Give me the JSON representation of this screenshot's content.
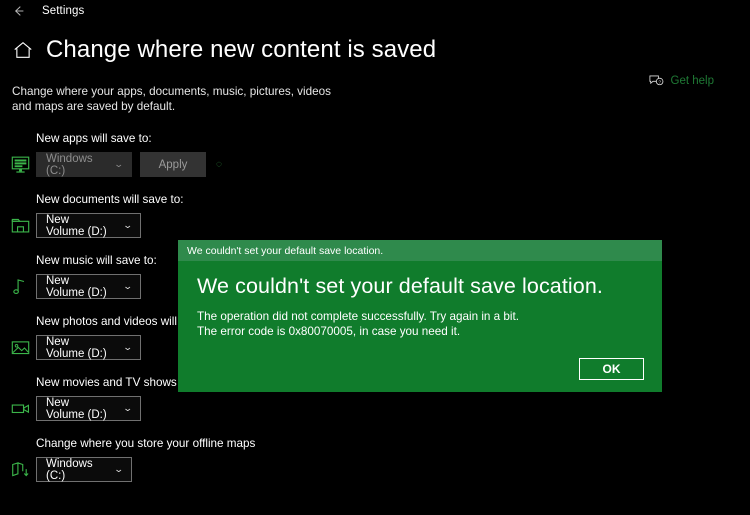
{
  "window": {
    "back_icon": "back-arrow-icon",
    "title": "Settings"
  },
  "header": {
    "home_icon": "home-icon",
    "title": "Change where new content is saved"
  },
  "description": "Change where your apps, documents, music, pictures, videos and maps are saved by default.",
  "help": {
    "icon": "help-chat-icon",
    "label": "Get help",
    "color": "#1f7a35"
  },
  "settings": [
    {
      "icon": "monitor-icon",
      "label": "New apps will save to:",
      "value": "Windows (C:)",
      "disabled": true,
      "apply_label": "Apply",
      "has_apply": true,
      "has_spinner": true,
      "width_class": "w-apps"
    },
    {
      "icon": "folder-icon",
      "label": "New documents will save to:",
      "value": "New Volume (D:)",
      "disabled": false,
      "has_apply": false,
      "has_spinner": false,
      "width_class": "w-vol"
    },
    {
      "icon": "music-note-icon",
      "label": "New music will save to:",
      "value": "New Volume (D:)",
      "disabled": false,
      "has_apply": false,
      "has_spinner": false,
      "width_class": "w-vol"
    },
    {
      "icon": "photo-icon",
      "label": "New photos and videos will save to:",
      "value": "New Volume (D:)",
      "disabled": false,
      "has_apply": false,
      "has_spinner": false,
      "width_class": "w-vol"
    },
    {
      "icon": "video-camera-icon",
      "label": "New movies and TV shows will save to:",
      "value": "New Volume (D:)",
      "disabled": false,
      "has_apply": false,
      "has_spinner": false,
      "width_class": "w-vol"
    },
    {
      "icon": "map-download-icon",
      "label": "Change where you store your offline maps",
      "value": "Windows (C:)",
      "disabled": false,
      "has_apply": false,
      "has_spinner": false,
      "width_class": "w-maps"
    }
  ],
  "dialog": {
    "titlebar_text": "We couldn't set your default save location.",
    "heading": "We couldn't set your default save location.",
    "body_line1": "The operation did not complete successfully. Try again in a bit.",
    "body_line2": "The error code is 0x80070005, in case you need it.",
    "ok_label": "OK",
    "background_color": "#107c2c",
    "titlebar_color": "#2f8a4c"
  },
  "chevron": "⌄"
}
